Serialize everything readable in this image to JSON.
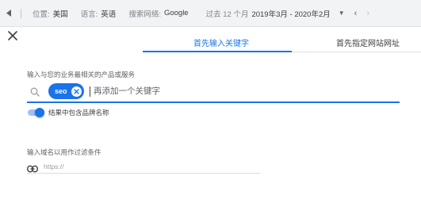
{
  "filters": {
    "location_label": "位置:",
    "location_value": "美国",
    "language_label": "语言:",
    "language_value": "英语",
    "network_label": "搜索网络:",
    "network_value": "Google",
    "period_label": "过去 12 个月",
    "period_value": "2019年3月 - 2020年2月"
  },
  "tabs": [
    {
      "label": "首先输入关键字",
      "active": true
    },
    {
      "label": "首先指定网站网址",
      "active": false
    }
  ],
  "product": {
    "prompt": "输入与您的业务最相关的产品或服务",
    "keywords": [
      "seo"
    ],
    "add_placeholder": "再添加一个关键字"
  },
  "brand_toggle": {
    "label": "结果中包含品牌名称",
    "on": true
  },
  "domain": {
    "prompt": "输入域名以用作过滤条件",
    "placeholder": "https://"
  },
  "colors": {
    "accent": "#1a73e8",
    "toolbar_bg": "#f1f3f4",
    "text": "#3c4043"
  },
  "icons": [
    "back-arrow-icon",
    "chevron-down-icon",
    "chevron-left-icon",
    "chevron-right-icon",
    "close-icon",
    "search-icon",
    "chip-remove-icon",
    "link-icon"
  ]
}
